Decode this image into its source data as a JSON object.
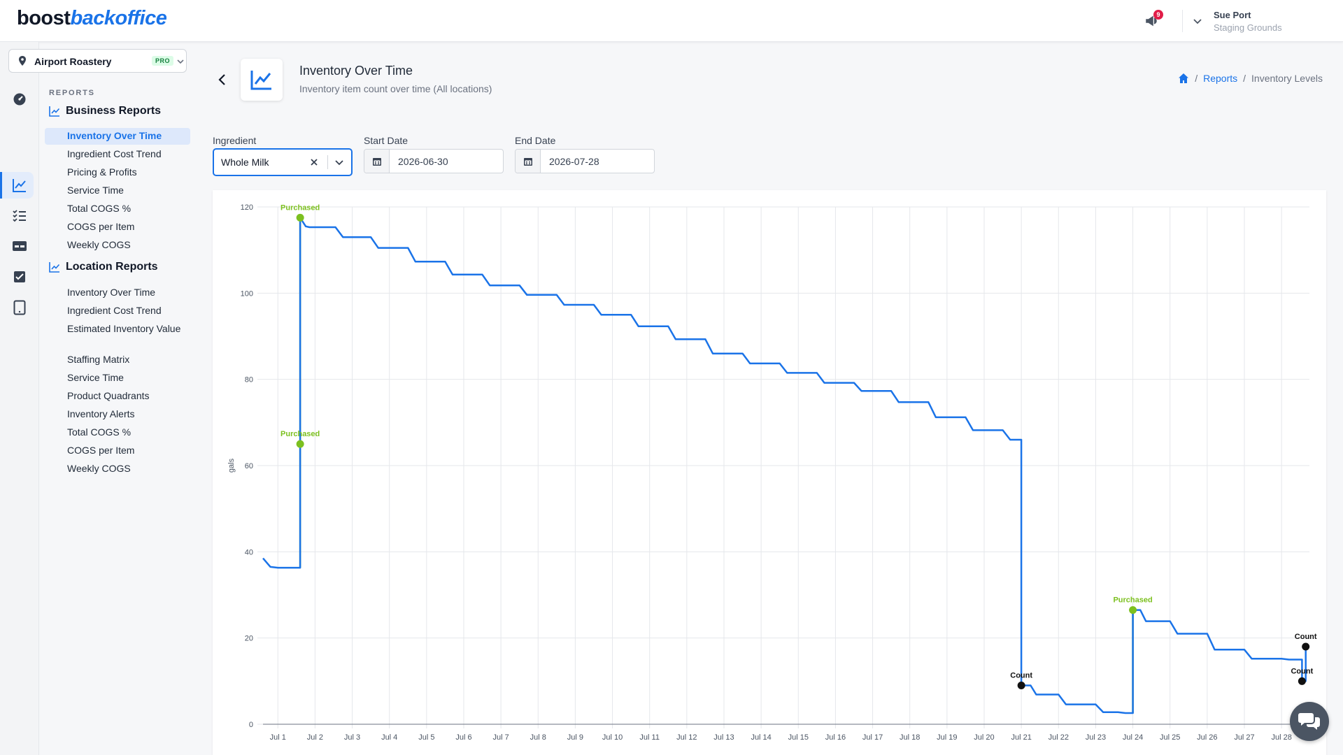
{
  "header": {
    "logo_part1": "boost",
    "logo_part2": "backoffice",
    "notification_count": "9",
    "user_name": "Sue Port",
    "user_org": "Staging Grounds"
  },
  "location": {
    "name": "Airport Roastery",
    "badge": "PRO"
  },
  "nav": {
    "section": "REPORTS",
    "business": {
      "title": "Business Reports",
      "items": [
        "Inventory Over Time",
        "Ingredient Cost Trend",
        "Pricing & Profits",
        "Service Time",
        "Total COGS %",
        "COGS per Item",
        "Weekly COGS"
      ]
    },
    "location": {
      "title": "Location Reports",
      "items": [
        "Inventory Over Time",
        "Ingredient Cost Trend",
        "Estimated Inventory Value",
        "Staffing Matrix",
        "Service Time",
        "Product Quadrants",
        "Inventory Alerts",
        "Total COGS %",
        "COGS per Item",
        "Weekly COGS"
      ]
    }
  },
  "page": {
    "title": "Inventory Over Time",
    "subtitle": "Inventory item count over time (All locations)"
  },
  "breadcrumb": {
    "reports": "Reports",
    "current": "Inventory Levels"
  },
  "filters": {
    "ingredient_label": "Ingredient",
    "ingredient_value": "Whole Milk",
    "start_label": "Start Date",
    "start_value": "2026-06-30",
    "end_label": "End Date",
    "end_value": "2026-07-28"
  },
  "colors": {
    "accent": "#1a73e8",
    "purchase": "#7cc01f",
    "count": "#111111"
  },
  "chart_data": {
    "type": "line",
    "ylabel": "gals",
    "ylim": [
      0,
      120
    ],
    "yticks": [
      0,
      20,
      40,
      60,
      80,
      100,
      120
    ],
    "x_range": [
      0.6,
      28.75
    ],
    "x_ticks": [
      "Jul 1",
      "Jul 2",
      "Jul 3",
      "Jul 4",
      "Jul 5",
      "Jul 6",
      "Jul 7",
      "Jul 8",
      "Jul 9",
      "Jul 10",
      "Jul 11",
      "Jul 12",
      "Jul 13",
      "Jul 14",
      "Jul 15",
      "Jul 16",
      "Jul 17",
      "Jul 18",
      "Jul 19",
      "Jul 20",
      "Jul 21",
      "Jul 22",
      "Jul 23",
      "Jul 24",
      "Jul 25",
      "Jul 26",
      "Jul 27",
      "Jul 28"
    ],
    "series": [
      {
        "x": [
          0.6,
          0.8,
          1.0,
          1.6,
          1.6,
          1.75,
          1.85,
          2.55,
          2.75,
          3.5,
          3.7,
          4.5,
          4.7,
          5.5,
          5.7,
          6.5,
          6.7,
          7.5,
          7.7,
          8.5,
          8.7,
          9.5,
          9.7,
          10.5,
          10.7,
          11.5,
          11.7,
          12.5,
          12.7,
          13.5,
          13.7,
          14.5,
          14.7,
          15.5,
          15.7,
          16.5,
          16.7,
          17.5,
          17.7,
          18.5,
          18.7,
          19.5,
          19.7,
          20.5,
          20.7,
          21.0,
          21.0,
          21.25,
          21.4,
          22.0,
          22.2,
          23.0,
          23.2,
          23.6,
          23.8,
          24.0,
          24.0,
          24.2,
          24.35,
          25.0,
          25.2,
          26.0,
          26.2,
          27.0,
          27.2,
          28.0,
          28.2,
          28.55,
          28.55,
          28.65,
          28.65
        ],
        "y": [
          38.5,
          36.5,
          36.3,
          36.3,
          117.5,
          115.5,
          115.3,
          115.3,
          113.0,
          113.0,
          110.5,
          110.5,
          107.3,
          107.3,
          104.3,
          104.3,
          101.8,
          101.8,
          99.6,
          99.6,
          97.3,
          97.3,
          95.0,
          95.0,
          92.3,
          92.3,
          89.3,
          89.3,
          86.0,
          86.0,
          83.7,
          83.7,
          81.5,
          81.5,
          79.2,
          79.2,
          77.3,
          77.3,
          74.7,
          74.7,
          71.2,
          71.2,
          68.2,
          68.2,
          66.0,
          66.0,
          9.0,
          9.0,
          6.9,
          6.9,
          4.6,
          4.6,
          2.8,
          2.8,
          2.6,
          2.6,
          26.5,
          26.5,
          23.9,
          23.9,
          21.0,
          21.0,
          17.3,
          17.3,
          15.2,
          15.2,
          15.0,
          15.0,
          10.0,
          10.0,
          18.0
        ]
      }
    ],
    "events": [
      {
        "label": "Purchased",
        "x": 1.6,
        "y": 117.5,
        "from": 36.3,
        "kind": "purchase"
      },
      {
        "label": "Purchased",
        "x": 1.6,
        "y": 65.0,
        "kind": "purchase"
      },
      {
        "label": "Purchased",
        "x": 24.0,
        "y": 26.5,
        "from": 2.6,
        "kind": "purchase"
      },
      {
        "label": "Count",
        "x": 21.0,
        "y": 9.0,
        "kind": "count"
      },
      {
        "label": "Count",
        "x": 28.55,
        "y": 10.0,
        "kind": "count"
      },
      {
        "label": "Count",
        "x": 28.65,
        "y": 18.0,
        "kind": "count"
      }
    ]
  }
}
